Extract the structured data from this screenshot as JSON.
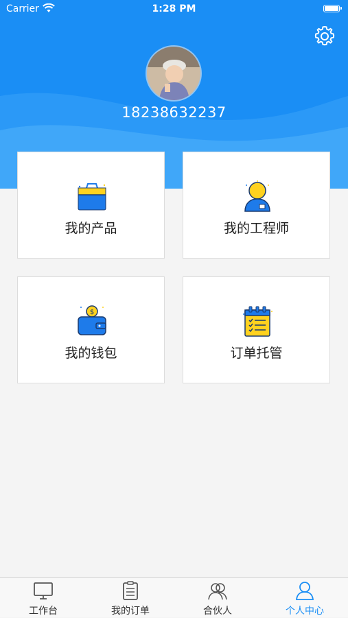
{
  "status_bar": {
    "carrier": "Carrier",
    "time": "1:28 PM"
  },
  "profile": {
    "phone": "18238632237"
  },
  "cards": [
    {
      "label": "我的产品",
      "icon": "shopping-bag-icon"
    },
    {
      "label": "我的工程师",
      "icon": "engineer-icon"
    },
    {
      "label": "我的钱包",
      "icon": "wallet-icon"
    },
    {
      "label": "订单托管",
      "icon": "checklist-icon"
    }
  ],
  "tabbar": [
    {
      "label": "工作台",
      "icon": "monitor-icon"
    },
    {
      "label": "我的订单",
      "icon": "clipboard-icon"
    },
    {
      "label": "合伙人",
      "icon": "partners-icon"
    },
    {
      "label": "个人中心",
      "icon": "person-icon",
      "active": true
    }
  ],
  "colors": {
    "accent": "#1a8ef5",
    "yellow": "#ffd21f",
    "blue": "#1e7bea"
  }
}
